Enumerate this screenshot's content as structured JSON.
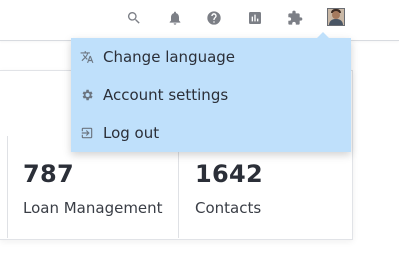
{
  "topbar": {
    "icons": [
      {
        "name": "search-icon"
      },
      {
        "name": "bell-icon"
      },
      {
        "name": "help-icon"
      },
      {
        "name": "bar-chart-icon"
      },
      {
        "name": "puzzle-icon"
      }
    ]
  },
  "user_menu": {
    "items": [
      {
        "icon": "translate-icon",
        "label": "Change language"
      },
      {
        "icon": "gear-icon",
        "label": "Account settings"
      },
      {
        "icon": "logout-icon",
        "label": "Log out"
      }
    ],
    "background_color": "#bfe0fb"
  },
  "stats": [
    {
      "value": "787",
      "label": "Loan Management"
    },
    {
      "value": "1642",
      "label": "Contacts"
    }
  ]
}
